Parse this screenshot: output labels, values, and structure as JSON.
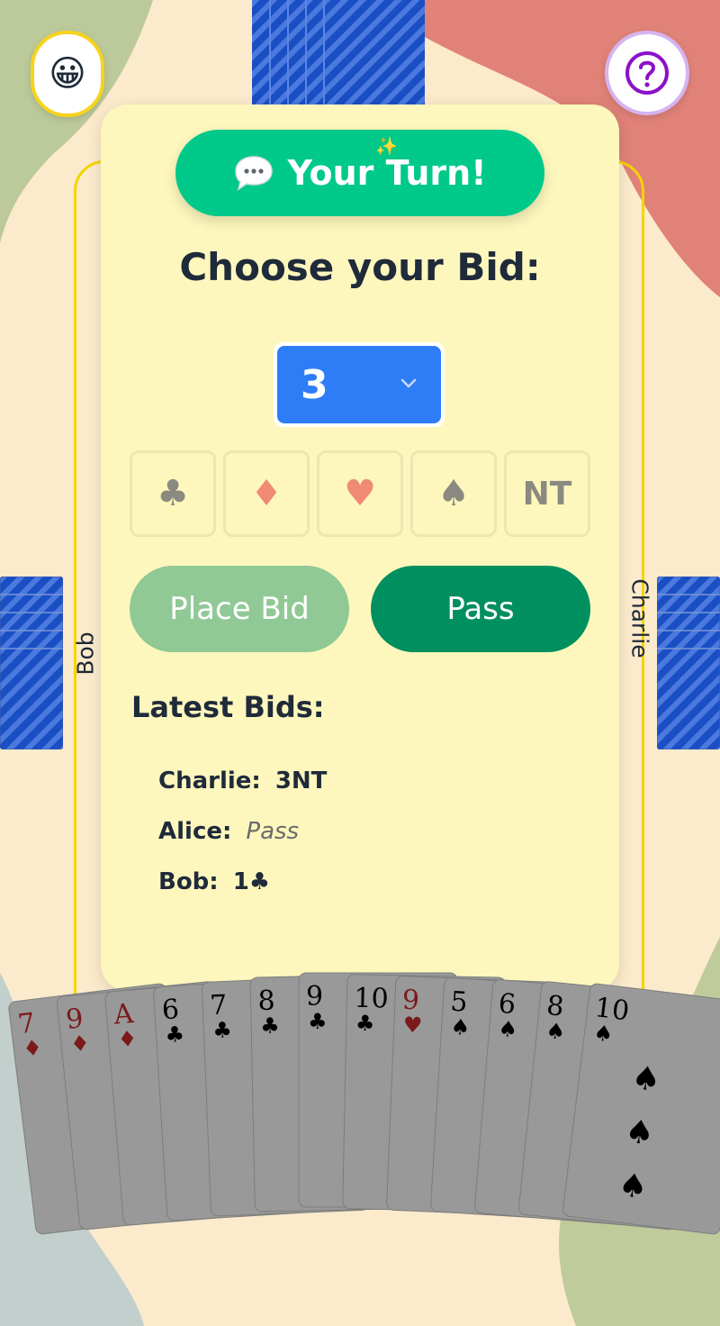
{
  "colors": {
    "table_bg": "#fbeacb",
    "panel_bg": "#fdf7bd",
    "turn_green": "#00c98a",
    "pass_green": "#008f5f",
    "place_bid_green": "#90c995",
    "select_blue": "#2f7df6",
    "card_back_blue": "#1a4fc4",
    "red_suit": "#f08a74",
    "black_suit": "#8a8a80"
  },
  "top_bar": {
    "emoji_button_icon": "grinning-face-icon",
    "emoji_glyph": "😀",
    "help_button_icon": "question-mark-icon"
  },
  "players": {
    "left": "Bob",
    "right": "Charlie"
  },
  "panel": {
    "turn_banner": "Your Turn!",
    "turn_icon": "speech-bubble-icon",
    "bid_title": "Choose your Bid:",
    "level_select": {
      "selected": "3"
    },
    "suits": [
      {
        "glyph": "♣",
        "name": "clubs",
        "color": "#8a8a80"
      },
      {
        "glyph": "♦",
        "name": "diamonds",
        "color": "#f08a74"
      },
      {
        "glyph": "♥",
        "name": "hearts",
        "color": "#f08a74"
      },
      {
        "glyph": "♠",
        "name": "spades",
        "color": "#8a8a80"
      },
      {
        "glyph": "NT",
        "name": "no-trump",
        "color": "#8a8a80"
      }
    ],
    "place_bid_label": "Place Bid",
    "pass_label": "Pass",
    "latest_bids_title": "Latest Bids:",
    "latest_bids": [
      {
        "player": "Charlie:",
        "bid": "3NT"
      },
      {
        "player": "Alice:",
        "bid": "Pass"
      },
      {
        "player": "Bob:",
        "bid": "1♣"
      }
    ]
  },
  "hand": [
    {
      "rank": "7",
      "suit": "♦"
    },
    {
      "rank": "9",
      "suit": "♦"
    },
    {
      "rank": "A",
      "suit": "♦"
    },
    {
      "rank": "6",
      "suit": "♣"
    },
    {
      "rank": "7",
      "suit": "♣"
    },
    {
      "rank": "8",
      "suit": "♣"
    },
    {
      "rank": "9",
      "suit": "♣"
    },
    {
      "rank": "10",
      "suit": "♣"
    },
    {
      "rank": "9",
      "suit": "♥"
    },
    {
      "rank": "5",
      "suit": "♠"
    },
    {
      "rank": "6",
      "suit": "♠"
    },
    {
      "rank": "8",
      "suit": "♠"
    },
    {
      "rank": "10",
      "suit": "♠"
    }
  ]
}
